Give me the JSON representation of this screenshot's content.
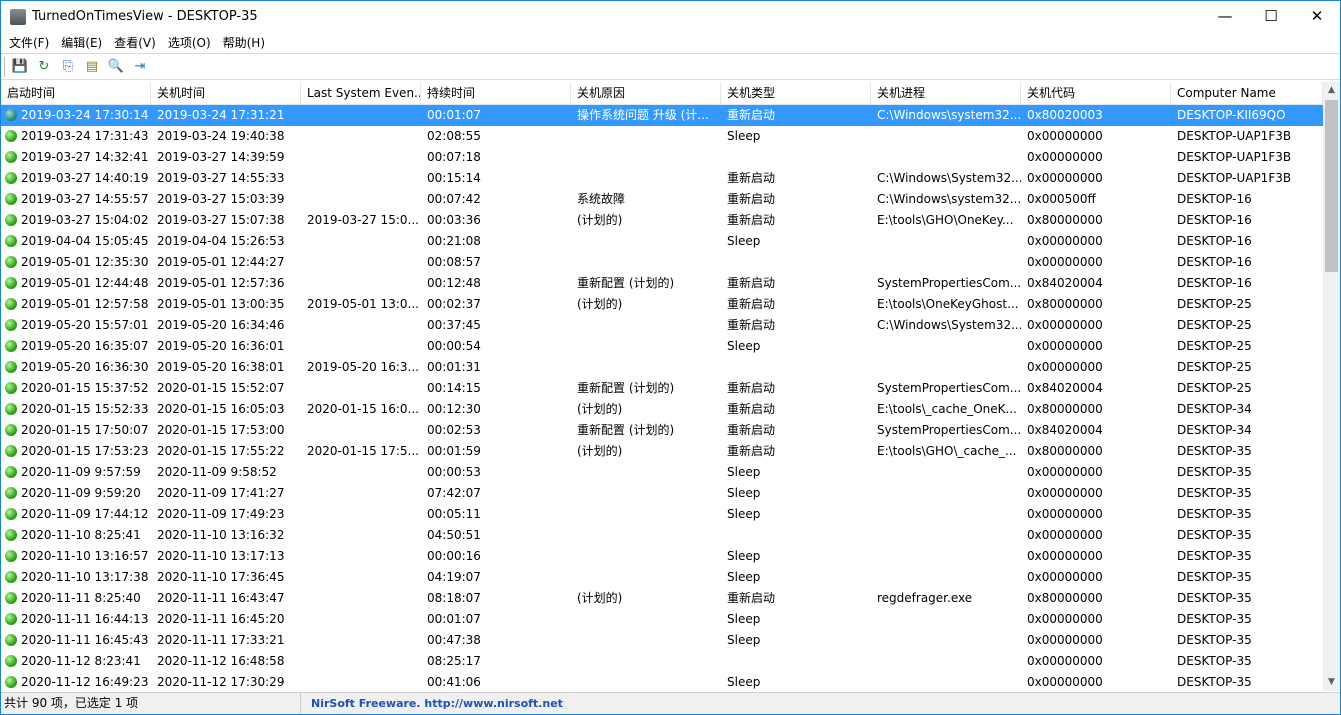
{
  "window": {
    "title": "TurnedOnTimesView  -  DESKTOP-35",
    "minimize": "—",
    "maximize": "☐",
    "close": "✕"
  },
  "menu": [
    "文件(F)",
    "编辑(E)",
    "查看(V)",
    "选项(O)",
    "帮助(H)"
  ],
  "toolbar": [
    {
      "icon": "save-icon",
      "glyph": "💾"
    },
    {
      "icon": "refresh-icon",
      "glyph": "↻"
    },
    {
      "icon": "copy-icon",
      "glyph": "⎘"
    },
    {
      "icon": "properties-icon",
      "glyph": "▤"
    },
    {
      "icon": "find-icon",
      "glyph": "🔍"
    },
    {
      "icon": "exit-icon",
      "glyph": "⇥"
    }
  ],
  "columns": [
    "启动时间",
    "关机时间",
    "Last System Even...",
    "持续时间",
    "关机原因",
    "关机类型",
    "关机进程",
    "关机代码",
    "Computer Name"
  ],
  "sort_indicator": "/",
  "rows": [
    [
      "2019-03-24 17:30:14",
      "2019-03-24 17:31:21",
      "",
      "00:01:07",
      "操作系统问题 升级 (计...",
      "重新启动",
      "C:\\Windows\\system32...",
      "0x80020003",
      "DESKTOP-KII69QO"
    ],
    [
      "2019-03-24 17:31:43",
      "2019-03-24 19:40:38",
      "",
      "02:08:55",
      "",
      "Sleep",
      "",
      "0x00000000",
      "DESKTOP-UAP1F3B"
    ],
    [
      "2019-03-27 14:32:41",
      "2019-03-27 14:39:59",
      "",
      "00:07:18",
      "",
      "",
      "",
      "0x00000000",
      "DESKTOP-UAP1F3B"
    ],
    [
      "2019-03-27 14:40:19",
      "2019-03-27 14:55:33",
      "",
      "00:15:14",
      "",
      "重新启动",
      "C:\\Windows\\System32...",
      "0x00000000",
      "DESKTOP-UAP1F3B"
    ],
    [
      "2019-03-27 14:55:57",
      "2019-03-27 15:03:39",
      "",
      "00:07:42",
      "系统故障",
      "重新启动",
      "C:\\Windows\\system32...",
      "0x000500ff",
      "DESKTOP-16"
    ],
    [
      "2019-03-27 15:04:02",
      "2019-03-27 15:07:38",
      "2019-03-27 15:0...",
      "00:03:36",
      " (计划的)",
      "重新启动",
      "E:\\tools\\GHO\\OneKey...",
      "0x80000000",
      "DESKTOP-16"
    ],
    [
      "2019-04-04 15:05:45",
      "2019-04-04 15:26:53",
      "",
      "00:21:08",
      "",
      "Sleep",
      "",
      "0x00000000",
      "DESKTOP-16"
    ],
    [
      "2019-05-01 12:35:30",
      "2019-05-01 12:44:27",
      "",
      "00:08:57",
      "",
      "",
      "",
      "0x00000000",
      "DESKTOP-16"
    ],
    [
      "2019-05-01 12:44:48",
      "2019-05-01 12:57:36",
      "",
      "00:12:48",
      "重新配置 (计划的)",
      "重新启动",
      "SystemPropertiesCom...",
      "0x84020004",
      "DESKTOP-16"
    ],
    [
      "2019-05-01 12:57:58",
      "2019-05-01 13:00:35",
      "2019-05-01 13:0...",
      "00:02:37",
      " (计划的)",
      "重新启动",
      "E:\\tools\\OneKeyGhost...",
      "0x80000000",
      "DESKTOP-25"
    ],
    [
      "2019-05-20 15:57:01",
      "2019-05-20 16:34:46",
      "",
      "00:37:45",
      "",
      "重新启动",
      "C:\\Windows\\System32...",
      "0x00000000",
      "DESKTOP-25"
    ],
    [
      "2019-05-20 16:35:07",
      "2019-05-20 16:36:01",
      "",
      "00:00:54",
      "",
      "Sleep",
      "",
      "0x00000000",
      "DESKTOP-25"
    ],
    [
      "2019-05-20 16:36:30",
      "2019-05-20 16:38:01",
      "2019-05-20 16:3...",
      "00:01:31",
      "",
      "",
      "",
      "0x00000000",
      "DESKTOP-25"
    ],
    [
      "2020-01-15 15:37:52",
      "2020-01-15 15:52:07",
      "",
      "00:14:15",
      "重新配置 (计划的)",
      "重新启动",
      "SystemPropertiesCom...",
      "0x84020004",
      "DESKTOP-25"
    ],
    [
      "2020-01-15 15:52:33",
      "2020-01-15 16:05:03",
      "2020-01-15 16:0...",
      "00:12:30",
      " (计划的)",
      "重新启动",
      "E:\\tools\\_cache_OneK...",
      "0x80000000",
      "DESKTOP-34"
    ],
    [
      "2020-01-15 17:50:07",
      "2020-01-15 17:53:00",
      "",
      "00:02:53",
      "重新配置 (计划的)",
      "重新启动",
      "SystemPropertiesCom...",
      "0x84020004",
      "DESKTOP-34"
    ],
    [
      "2020-01-15 17:53:23",
      "2020-01-15 17:55:22",
      "2020-01-15 17:5...",
      "00:01:59",
      " (计划的)",
      "重新启动",
      "E:\\tools\\GHO\\_cache_...",
      "0x80000000",
      "DESKTOP-35"
    ],
    [
      "2020-11-09 9:57:59",
      "2020-11-09 9:58:52",
      "",
      "00:00:53",
      "",
      "Sleep",
      "",
      "0x00000000",
      "DESKTOP-35"
    ],
    [
      "2020-11-09 9:59:20",
      "2020-11-09 17:41:27",
      "",
      "07:42:07",
      "",
      "Sleep",
      "",
      "0x00000000",
      "DESKTOP-35"
    ],
    [
      "2020-11-09 17:44:12",
      "2020-11-09 17:49:23",
      "",
      "00:05:11",
      "",
      "Sleep",
      "",
      "0x00000000",
      "DESKTOP-35"
    ],
    [
      "2020-11-10 8:25:41",
      "2020-11-10 13:16:32",
      "",
      "04:50:51",
      "",
      "",
      "",
      "0x00000000",
      "DESKTOP-35"
    ],
    [
      "2020-11-10 13:16:57",
      "2020-11-10 13:17:13",
      "",
      "00:00:16",
      "",
      "Sleep",
      "",
      "0x00000000",
      "DESKTOP-35"
    ],
    [
      "2020-11-10 13:17:38",
      "2020-11-10 17:36:45",
      "",
      "04:19:07",
      "",
      "Sleep",
      "",
      "0x00000000",
      "DESKTOP-35"
    ],
    [
      "2020-11-11 8:25:40",
      "2020-11-11 16:43:47",
      "",
      "08:18:07",
      " (计划的)",
      "重新启动",
      "regdefrager.exe",
      "0x80000000",
      "DESKTOP-35"
    ],
    [
      "2020-11-11 16:44:13",
      "2020-11-11 16:45:20",
      "",
      "00:01:07",
      "",
      "Sleep",
      "",
      "0x00000000",
      "DESKTOP-35"
    ],
    [
      "2020-11-11 16:45:43",
      "2020-11-11 17:33:21",
      "",
      "00:47:38",
      "",
      "Sleep",
      "",
      "0x00000000",
      "DESKTOP-35"
    ],
    [
      "2020-11-12 8:23:41",
      "2020-11-12 16:48:58",
      "",
      "08:25:17",
      "",
      "",
      "",
      "0x00000000",
      "DESKTOP-35"
    ],
    [
      "2020-11-12 16:49:23",
      "2020-11-12 17:30:29",
      "",
      "00:41:06",
      "",
      "Sleep",
      "",
      "0x00000000",
      "DESKTOP-35"
    ]
  ],
  "selected_row": 0,
  "scroll": {
    "up": "▲",
    "down": "▼"
  },
  "status": {
    "count": "共计 90 项，已选定 1 项",
    "credit": "NirSoft Freeware.  http://www.nirsoft.net"
  }
}
